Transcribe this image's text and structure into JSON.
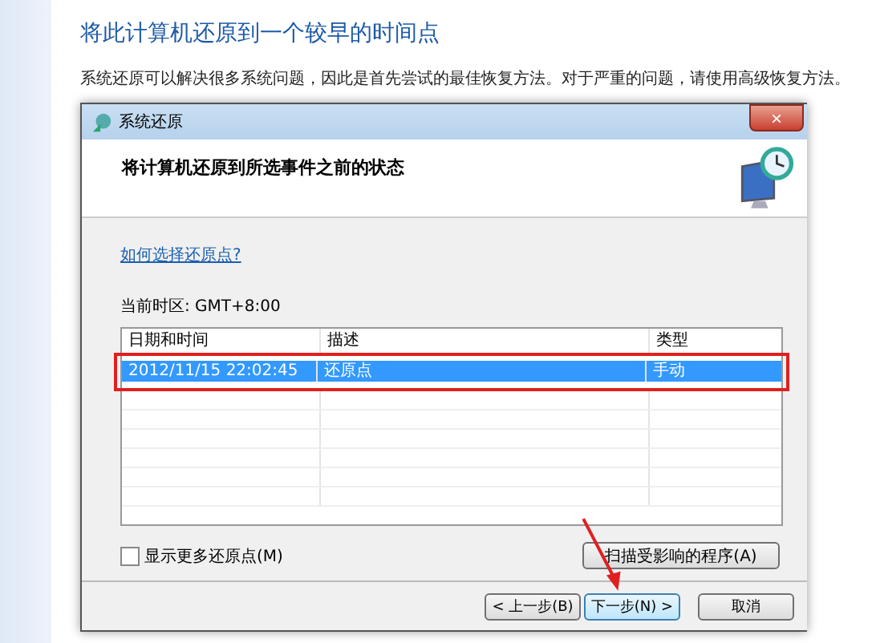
{
  "page": {
    "heading": "将此计算机还原到一个较早的时间点",
    "description": "系统还原可以解决很多系统问题，因此是首先尝试的最佳恢复方法。对于严重的问题，请使用高级恢复方法。"
  },
  "dialog": {
    "title": "系统还原",
    "close": "×",
    "header": "将计算机还原到所选事件之前的状态",
    "link": "如何选择还原点?",
    "timezone": "当前时区: GMT+8:00",
    "table": {
      "columns": [
        "日期和时间",
        "描述",
        "类型"
      ],
      "rows": [
        {
          "cells": [
            "2012/11/15 22:02:45",
            "还原点",
            "手动"
          ],
          "selected": true
        }
      ]
    },
    "show_more": {
      "label": "显示更多还原点(M)",
      "checked": false
    },
    "scan_button": "扫描受影响的程序(A)",
    "buttons": [
      {
        "label": "< 上一步(B)",
        "selected": false
      },
      {
        "label": "下一步(N) >",
        "selected": true
      },
      {
        "label": "取消",
        "selected": false
      }
    ]
  }
}
